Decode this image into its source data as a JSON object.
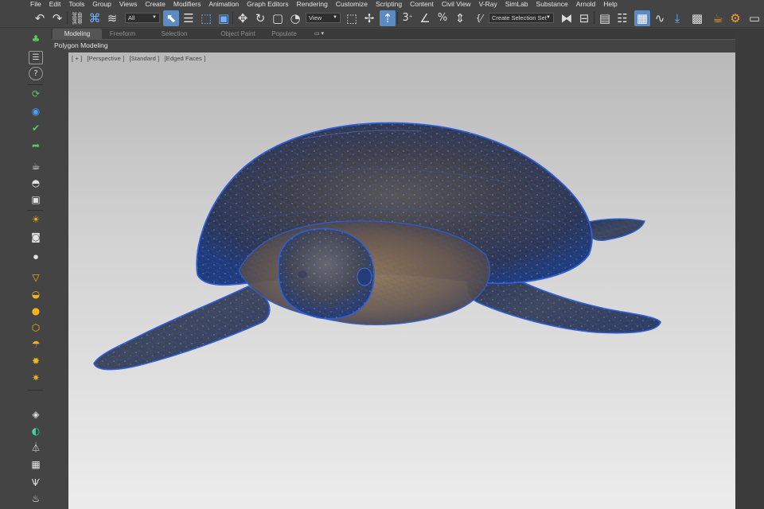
{
  "menubar": {
    "items": [
      "File",
      "Edit",
      "Tools",
      "Group",
      "Views",
      "Create",
      "Modifiers",
      "Animation",
      "Graph Editors",
      "Rendering",
      "Customize",
      "Scripting",
      "Content",
      "Civil View",
      "V-Ray",
      "SimLab",
      "Substance",
      "Arnold",
      "Help"
    ]
  },
  "toolbar": {
    "selection_filter": "All",
    "reference_coord": "View",
    "snap_value": "3",
    "named_selection_placeholder": "Create Selection Set",
    "icons": [
      "undo-icon",
      "redo-icon",
      "select-and-link-icon",
      "unlink-icon",
      "bind-to-spacewarp-icon",
      "select-object-icon",
      "select-by-name-icon",
      "rectangular-selection-icon",
      "window-crossing-icon",
      "select-and-move-icon",
      "select-and-rotate-icon",
      "select-and-scale-icon",
      "select-and-place-icon",
      "pivot-icon",
      "snaps-toggle-icon",
      "angle-snap-icon",
      "percent-snap-icon",
      "spinner-snap-icon",
      "edit-named-selection-icon",
      "mirror-icon",
      "align-icon",
      "scene-explorer-icon",
      "layer-explorer-icon",
      "ribbon-toggle-icon",
      "curve-editor-icon",
      "schematic-view-icon",
      "material-editor-icon",
      "render-setup-icon",
      "render-icon"
    ]
  },
  "ribbon": {
    "tabs": [
      {
        "label": "Modeling",
        "active": true
      },
      {
        "label": "Freeform",
        "active": false
      },
      {
        "label": "Selection",
        "active": false
      },
      {
        "label": "Object Paint",
        "active": false
      },
      {
        "label": "Populate",
        "active": false
      }
    ],
    "panel_label": "Polygon Modeling"
  },
  "viewport": {
    "labels": [
      "[ + ]",
      "[Perspective ]",
      "[Standard ]",
      "[Edged Faces ]"
    ],
    "background_top": "#b9b9b9",
    "background_bottom": "#ececec",
    "object": "sea-turtle-mesh"
  },
  "left_toolbar": {
    "icons": [
      "scene-tree-icon",
      "list-icon",
      "help-icon",
      "refresh-green-icon",
      "object-blue-icon",
      "object-check-icon",
      "object-arrow-icon",
      "teapot-icon",
      "sphere-cap-icon",
      "box-display-icon",
      "light-bulb-icon",
      "camera-icon",
      "video-camera-icon",
      "spotlight-icon",
      "half-sphere-icon",
      "sphere-icon",
      "geosphere-icon",
      "mushroom-icon",
      "sun-icon",
      "sunburst-icon",
      "cube-icon",
      "disc-icon",
      "tripod-icon",
      "box-grid-icon",
      "grass-icon",
      "fire-icon"
    ]
  },
  "colors": {
    "ui_bg": "#444444",
    "active_button": "#5b8bc2",
    "accent_yellow": "#f2b418",
    "accent_green": "#5cc85c",
    "mesh_wire": "#2f5fd8"
  }
}
